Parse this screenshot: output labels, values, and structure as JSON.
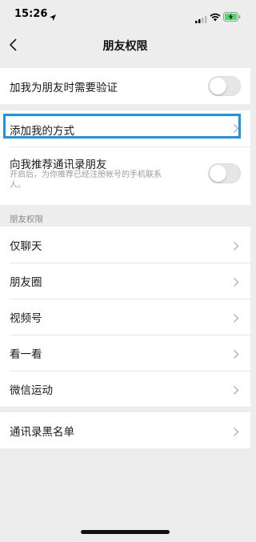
{
  "status_bar": {
    "time": "15:26"
  },
  "nav": {
    "title": "朋友权限"
  },
  "settings": {
    "verify_label": "加我为朋友时需要验证",
    "add_methods_label": "添加我的方式",
    "recommend_label": "向我推荐通讯录朋友",
    "recommend_desc": "开启后，为你推荐已经注册帐号的手机联系人。"
  },
  "permissions": {
    "header": "朋友权限",
    "items": [
      {
        "label": "仅聊天"
      },
      {
        "label": "朋友圈"
      },
      {
        "label": "视频号"
      },
      {
        "label": "看一看"
      },
      {
        "label": "微信运动"
      }
    ]
  },
  "blacklist": {
    "label": "通讯录黑名单"
  },
  "colors": {
    "highlight": "#1e94e8",
    "background": "#ededed"
  }
}
